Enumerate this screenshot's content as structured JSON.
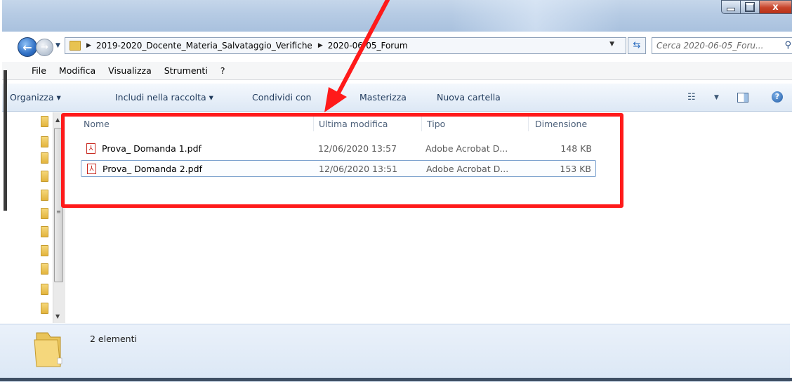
{
  "window": {
    "close_glyph": "x"
  },
  "navigation": {
    "breadcrumbs": [
      "2019-2020_Docente_Materia_Salvataggio_Verifiche",
      "2020-06-05_Forum"
    ],
    "search_placeholder": "Cerca 2020-06-05_Foru..."
  },
  "menu": [
    "File",
    "Modifica",
    "Visualizza",
    "Strumenti",
    "?"
  ],
  "commands": {
    "organize": "Organizza ▾",
    "include": "Includi nella raccolta ▾",
    "share": "Condividi con",
    "burn": "Masterizza",
    "new_folder": "Nuova cartella"
  },
  "columns": {
    "name": "Nome",
    "modified": "Ultima modifica",
    "type": "Tipo",
    "size": "Dimensione"
  },
  "files": [
    {
      "name": "Prova_ Domanda 1.pdf",
      "modified": "12/06/2020 13:57",
      "type": "Adobe Acrobat D...",
      "size": "148 KB"
    },
    {
      "name": "Prova_ Domanda 2.pdf",
      "modified": "12/06/2020 13:51",
      "type": "Adobe Acrobat D...",
      "size": "153 KB"
    }
  ],
  "selected_file_index": 1,
  "status": {
    "count_text": "2 elementi"
  },
  "colors": {
    "annotation": "#ff1a1a",
    "accent": "#1e395b"
  },
  "icons": {
    "back": "back-arrow-icon",
    "forward": "forward-arrow-icon",
    "refresh": "refresh-icon",
    "search": "search-icon",
    "view": "view-options-icon",
    "pane": "preview-pane-icon",
    "help": "help-icon",
    "pdf": "pdf-file-icon",
    "folder": "folder-icon"
  }
}
